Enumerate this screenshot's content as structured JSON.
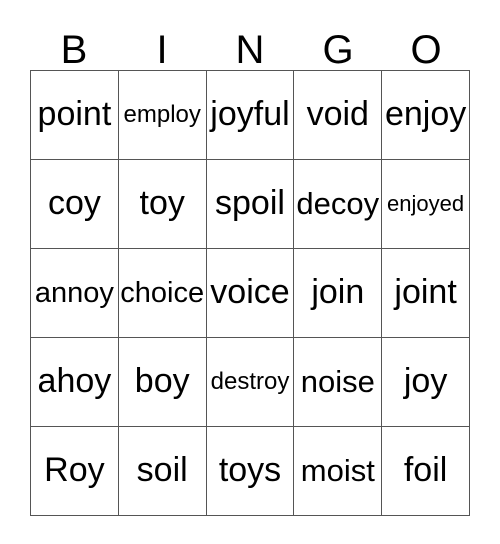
{
  "card": {
    "headers": [
      "B",
      "I",
      "N",
      "G",
      "O"
    ],
    "rows": [
      [
        {
          "word": "point",
          "size": "fs-xl"
        },
        {
          "word": "employ",
          "size": "fs-sm"
        },
        {
          "word": "joyful",
          "size": "fs-xl"
        },
        {
          "word": "void",
          "size": "fs-xl"
        },
        {
          "word": "enjoy",
          "size": "fs-xl"
        }
      ],
      [
        {
          "word": "coy",
          "size": "fs-xl"
        },
        {
          "word": "toy",
          "size": "fs-xl"
        },
        {
          "word": "spoil",
          "size": "fs-xl"
        },
        {
          "word": "decoy",
          "size": "fs-lg"
        },
        {
          "word": "enjoyed",
          "size": "fs-xs"
        }
      ],
      [
        {
          "word": "annoy",
          "size": "fs-md"
        },
        {
          "word": "choice",
          "size": "fs-md"
        },
        {
          "word": "voice",
          "size": "fs-xl"
        },
        {
          "word": "join",
          "size": "fs-xl"
        },
        {
          "word": "joint",
          "size": "fs-xl"
        }
      ],
      [
        {
          "word": "ahoy",
          "size": "fs-xl"
        },
        {
          "word": "boy",
          "size": "fs-xl"
        },
        {
          "word": "destroy",
          "size": "fs-sm"
        },
        {
          "word": "noise",
          "size": "fs-lg"
        },
        {
          "word": "joy",
          "size": "fs-xl"
        }
      ],
      [
        {
          "word": "Roy",
          "size": "fs-xl"
        },
        {
          "word": "soil",
          "size": "fs-xl"
        },
        {
          "word": "toys",
          "size": "fs-xl"
        },
        {
          "word": "moist",
          "size": "fs-lg"
        },
        {
          "word": "foil",
          "size": "fs-xl"
        }
      ]
    ]
  },
  "colors": {
    "background": "#ffffff",
    "text": "#000000",
    "grid_line": "#555555"
  }
}
